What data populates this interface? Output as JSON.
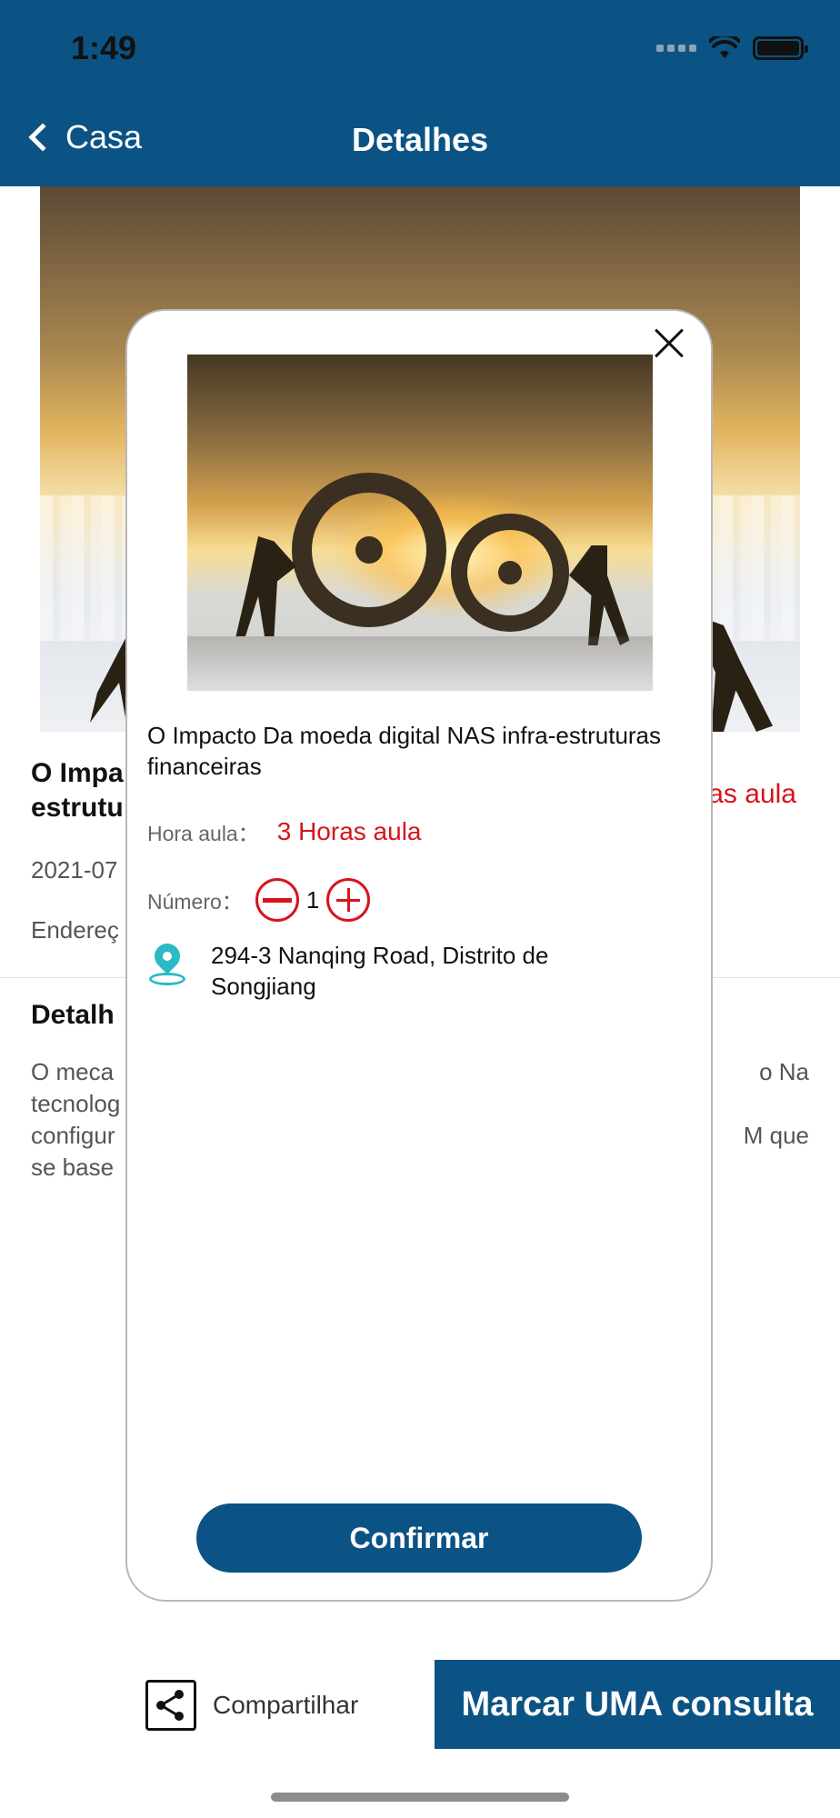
{
  "status_bar": {
    "time": "1:49"
  },
  "nav": {
    "back_label": "Casa",
    "title": "Detalhes"
  },
  "background_page": {
    "title": "O Impacto Da moeda digital NAS infra-estruturas financeiras",
    "title_visible": "O Impa\nestrutu",
    "price_visible": "as aula",
    "date_visible": "2021-07",
    "address_visible": "Endereç",
    "section_title_visible": "Detalh",
    "body_visible_left": "O meca\ntecnolog\nconfigur\nse base",
    "body_visible_right": "o Na\n\nM que"
  },
  "modal": {
    "title": "O Impacto Da moeda digital NAS infra-estruturas financeiras",
    "hours_label": "Hora aula：",
    "hours_value": "3 Horas aula",
    "number_label": "Número：",
    "quantity": "1",
    "address": "294-3 Nanqing Road, Distrito de Songjiang",
    "confirm_label": "Confirmar"
  },
  "bottom_bar": {
    "share_label": "Compartilhar",
    "cta_label": "Marcar UMA consulta"
  },
  "colors": {
    "primary": "#0b5384",
    "accent_red": "#d7141a",
    "pin": "#2bbac7"
  }
}
